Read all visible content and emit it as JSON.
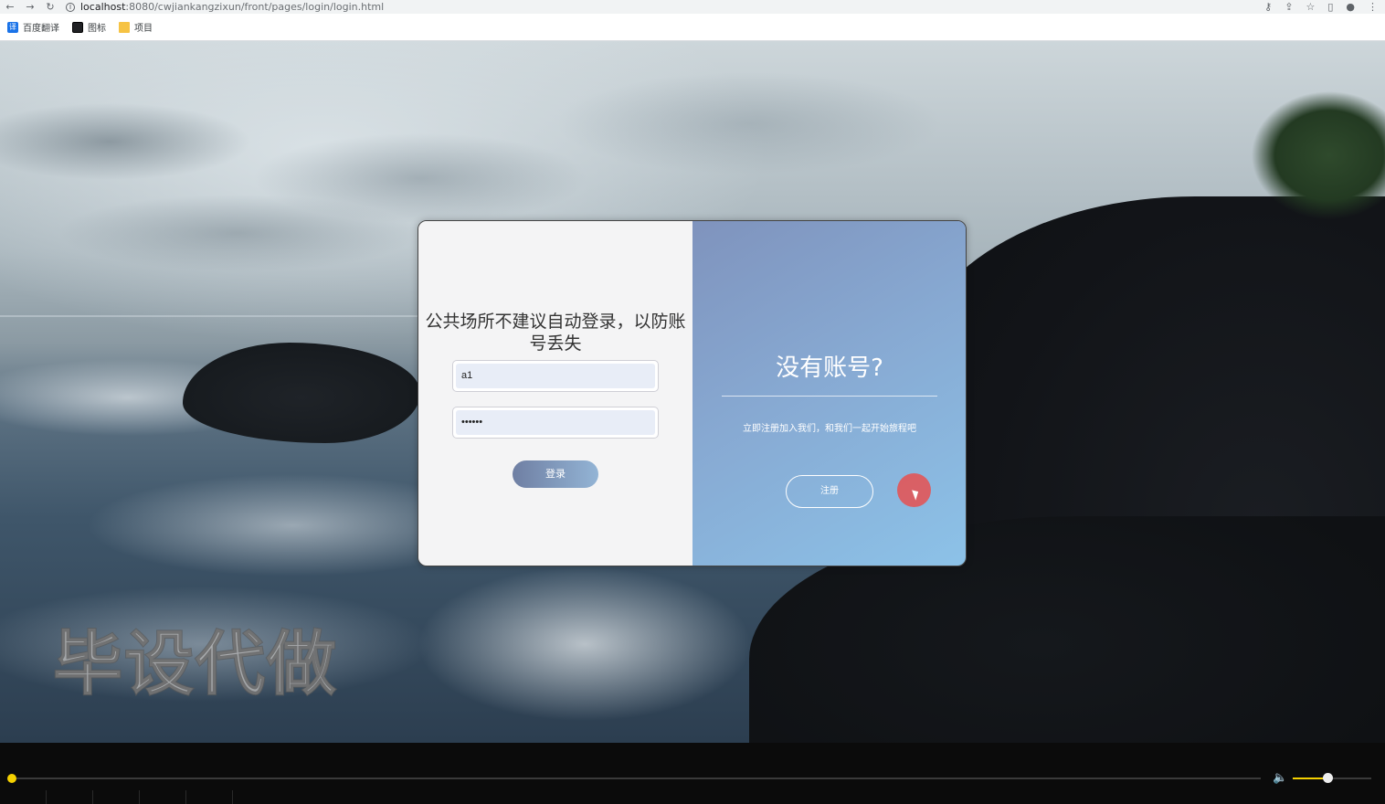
{
  "browser": {
    "url_host": "localhost",
    "url_rest": ":8080/cwjiankangzixun/front/pages/login/login.html",
    "bookmarks": [
      {
        "label": "百度翻译",
        "icon": "translate-icon"
      },
      {
        "label": "图标",
        "icon": "image-icon"
      },
      {
        "label": "项目",
        "icon": "folder-icon"
      }
    ]
  },
  "login": {
    "hint": "公共场所不建议自动登录，以防账号丢失",
    "username_value": "a1",
    "password_value": "••••••",
    "login_label": "登录"
  },
  "register_panel": {
    "title": "没有账号?",
    "subtitle": "立即注册加入我们，和我们一起开始旅程吧",
    "register_label": "注册"
  },
  "watermark": "毕设代做",
  "player": {
    "progress": 0.0,
    "volume": 0.45,
    "accent": "#f5d100"
  },
  "colors": {
    "panel_gradient_start": "#7f93bd",
    "panel_gradient_end": "#8cc2e8"
  }
}
